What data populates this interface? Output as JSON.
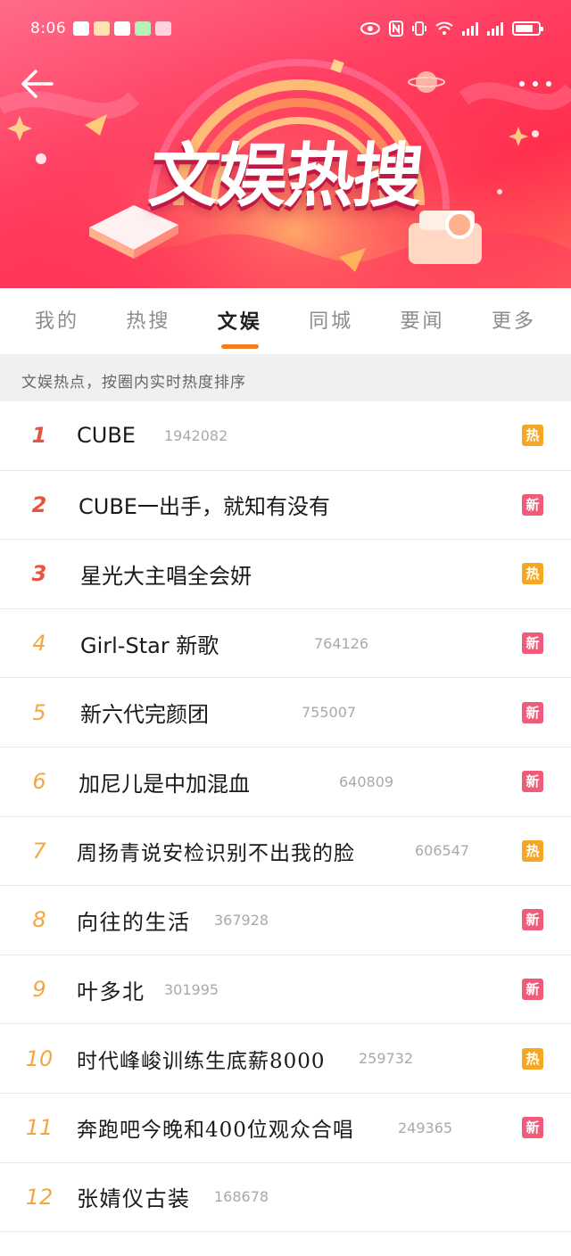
{
  "status": {
    "time": "8:06",
    "network": "4G"
  },
  "banner": {
    "title": "文娱热搜"
  },
  "tabs": [
    {
      "label": "我的"
    },
    {
      "label": "热搜"
    },
    {
      "label": "文娱"
    },
    {
      "label": "同城"
    },
    {
      "label": "要闻"
    },
    {
      "label": "更多"
    }
  ],
  "active_tab": "文娱",
  "subheader": "文娱热点，按圈内实时热度排序",
  "items": [
    {
      "rank": "1",
      "title": "CUBE",
      "count": "1942082",
      "badge": "热"
    },
    {
      "rank": "2",
      "title": "CUBE一出手，就知有没有",
      "count": "",
      "badge": "新"
    },
    {
      "rank": "3",
      "title": "星光大主唱全会妍",
      "count": "",
      "badge": "热"
    },
    {
      "rank": "4",
      "title": "Girl-Star 新歌",
      "count": "764126",
      "badge": "新"
    },
    {
      "rank": "5",
      "title": "新六代完颜团",
      "count": "755007",
      "badge": "新"
    },
    {
      "rank": "6",
      "title": "加尼儿是中加混血",
      "count": "640809",
      "badge": "新"
    },
    {
      "rank": "7",
      "title": "周扬青说安检识别不出我的脸",
      "count": "606547",
      "badge": "热"
    },
    {
      "rank": "8",
      "title": "向往的生活",
      "count": "367928",
      "badge": "新"
    },
    {
      "rank": "9",
      "title": "叶多北",
      "count": "301995",
      "badge": "新"
    },
    {
      "rank": "10",
      "title": "时代峰峻训练生底薪8000",
      "count": "259732",
      "badge": "热"
    },
    {
      "rank": "11",
      "title": "奔跑吧今晚和400位观众合唱",
      "count": "249365",
      "badge": "新"
    },
    {
      "rank": "12",
      "title": "张婧仪古装",
      "count": "168678",
      "badge": ""
    }
  ],
  "colors": {
    "rank_top": "#e8543d",
    "rank_other": "#f2a641",
    "badge_hot": "#f5a623",
    "badge_new": "#ef5b79",
    "tab_indicator": "#f57c1f"
  }
}
